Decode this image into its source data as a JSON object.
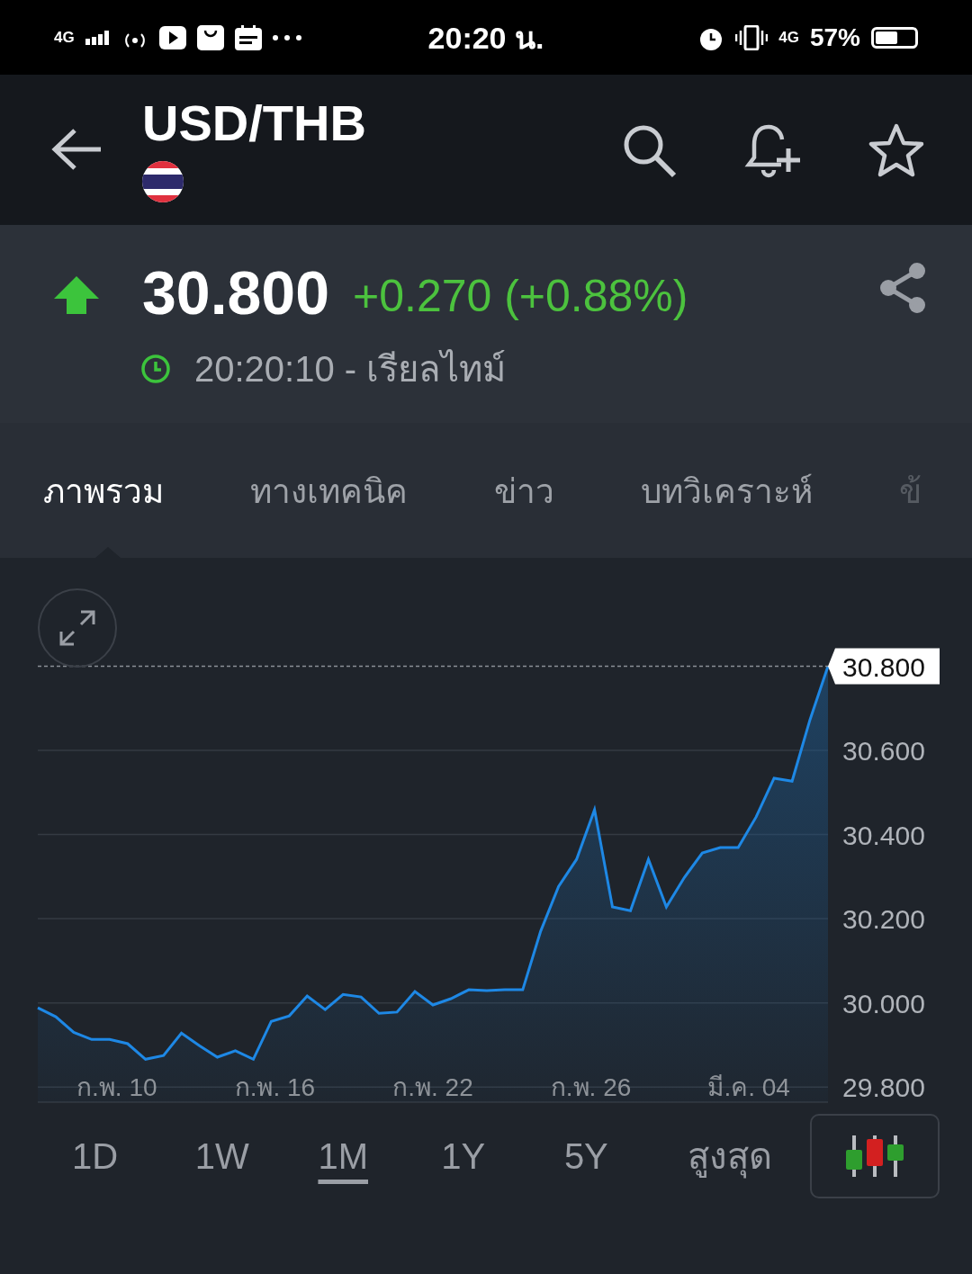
{
  "status_bar": {
    "network_left": "4G",
    "time": "20:20 น.",
    "network_right": "4G",
    "battery": "57%"
  },
  "header": {
    "title": "USD/THB"
  },
  "quote": {
    "price": "30.800",
    "change": "+0.270 (+0.88%)",
    "up": true,
    "time": "20:20:10 - เรียลไทม์"
  },
  "tabs": [
    {
      "label": "ภาพรวม",
      "selected": true
    },
    {
      "label": "ทางเทคนิค",
      "selected": false
    },
    {
      "label": "ข่าว",
      "selected": false
    },
    {
      "label": "บทวิเคราะห์",
      "selected": false
    },
    {
      "label": "ข้",
      "selected": false
    }
  ],
  "chart": {
    "date_labels": [
      "ก.พ. 10",
      "ก.พ. 16",
      "ก.พ. 22",
      "ก.พ. 26",
      "มี.ค. 04"
    ],
    "chart_data": {
      "type": "area",
      "grid": true,
      "ylim": [
        29.764,
        30.8
      ],
      "yticks": [
        {
          "value": 29.8,
          "label": "29.800"
        },
        {
          "value": 30.0,
          "label": "30.000"
        },
        {
          "value": 30.2,
          "label": "30.200"
        },
        {
          "value": 30.4,
          "label": "30.400"
        },
        {
          "value": 30.6,
          "label": "30.600"
        },
        {
          "value": 30.8,
          "label": "30.800"
        }
      ],
      "series": [
        {
          "color": "#1e88e5",
          "values": [
            29.988,
            29.967,
            29.93,
            29.913,
            29.913,
            29.903,
            29.866,
            29.875,
            29.928,
            29.898,
            29.871,
            29.886,
            29.866,
            29.956,
            29.969,
            30.016,
            29.984,
            30.02,
            30.014,
            29.975,
            29.978,
            30.027,
            29.995,
            30.01,
            30.031,
            30.029,
            30.031,
            30.031,
            30.17,
            30.277,
            30.341,
            30.459,
            30.228,
            30.219,
            30.341,
            30.228,
            30.298,
            30.356,
            30.369,
            30.369,
            30.442,
            30.534,
            30.527,
            30.673,
            30.8
          ]
        }
      ]
    }
  },
  "ranges": [
    {
      "label": "1D",
      "selected": false
    },
    {
      "label": "1W",
      "selected": false
    },
    {
      "label": "1M",
      "selected": true
    },
    {
      "label": "1Y",
      "selected": false
    },
    {
      "label": "5Y",
      "selected": false
    },
    {
      "label": "สูงสุด",
      "selected": false
    }
  ]
}
